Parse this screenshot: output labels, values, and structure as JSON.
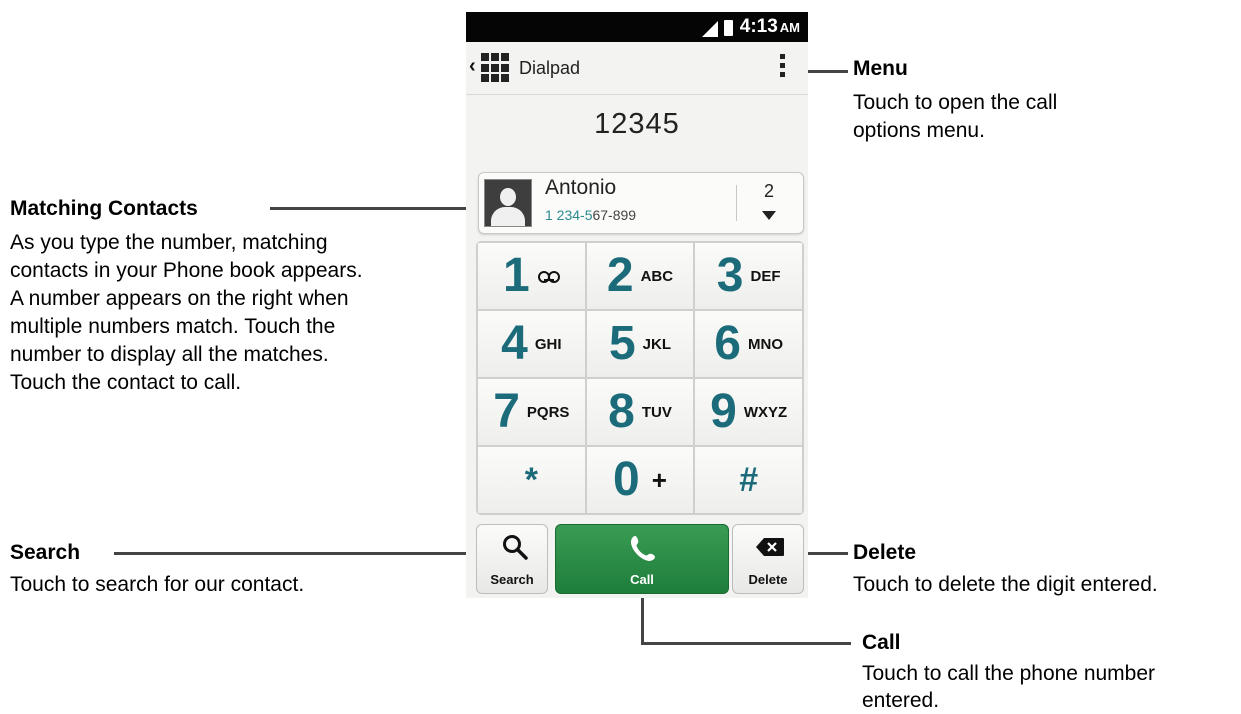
{
  "status_bar": {
    "time": "4:13",
    "ampm": "AM"
  },
  "action_bar": {
    "title": "Dialpad"
  },
  "dialed_number": "12345",
  "match": {
    "name": "Antonio",
    "number_highlight": "1 234-5",
    "number_rest": "67-899",
    "count": "2"
  },
  "keys": [
    {
      "digit": "1",
      "letters": ""
    },
    {
      "digit": "2",
      "letters": "ABC"
    },
    {
      "digit": "3",
      "letters": "DEF"
    },
    {
      "digit": "4",
      "letters": "GHI"
    },
    {
      "digit": "5",
      "letters": "JKL"
    },
    {
      "digit": "6",
      "letters": "MNO"
    },
    {
      "digit": "7",
      "letters": "PQRS"
    },
    {
      "digit": "8",
      "letters": "TUV"
    },
    {
      "digit": "9",
      "letters": "WXYZ"
    },
    {
      "digit": "*",
      "letters": ""
    },
    {
      "digit": "0",
      "letters": "+"
    },
    {
      "digit": "#",
      "letters": ""
    }
  ],
  "buttons": {
    "search": "Search",
    "call": "Call",
    "delete": "Delete"
  },
  "annotations": {
    "menu": {
      "title": "Menu",
      "lines": [
        "Touch to open the call",
        "options menu."
      ]
    },
    "matching": {
      "title": "Matching Contacts",
      "lines": [
        "As you type the number, matching",
        "contacts in your Phone book appears.",
        "A number appears on the right when",
        "multiple numbers match. Touch the",
        "number to display all the matches.",
        "Touch the contact to call."
      ]
    },
    "search": {
      "title": "Search",
      "lines": [
        "Touch to search for our contact."
      ]
    },
    "delete": {
      "title": "Delete",
      "lines": [
        "Touch to delete the digit entered."
      ]
    },
    "call": {
      "title": "Call",
      "lines": [
        "Touch to call the phone number",
        "entered."
      ]
    }
  },
  "colors": {
    "accent_teal": "#1b6b7a",
    "call_green": "#2a8c45",
    "match_highlight": "#2a8a8f"
  }
}
